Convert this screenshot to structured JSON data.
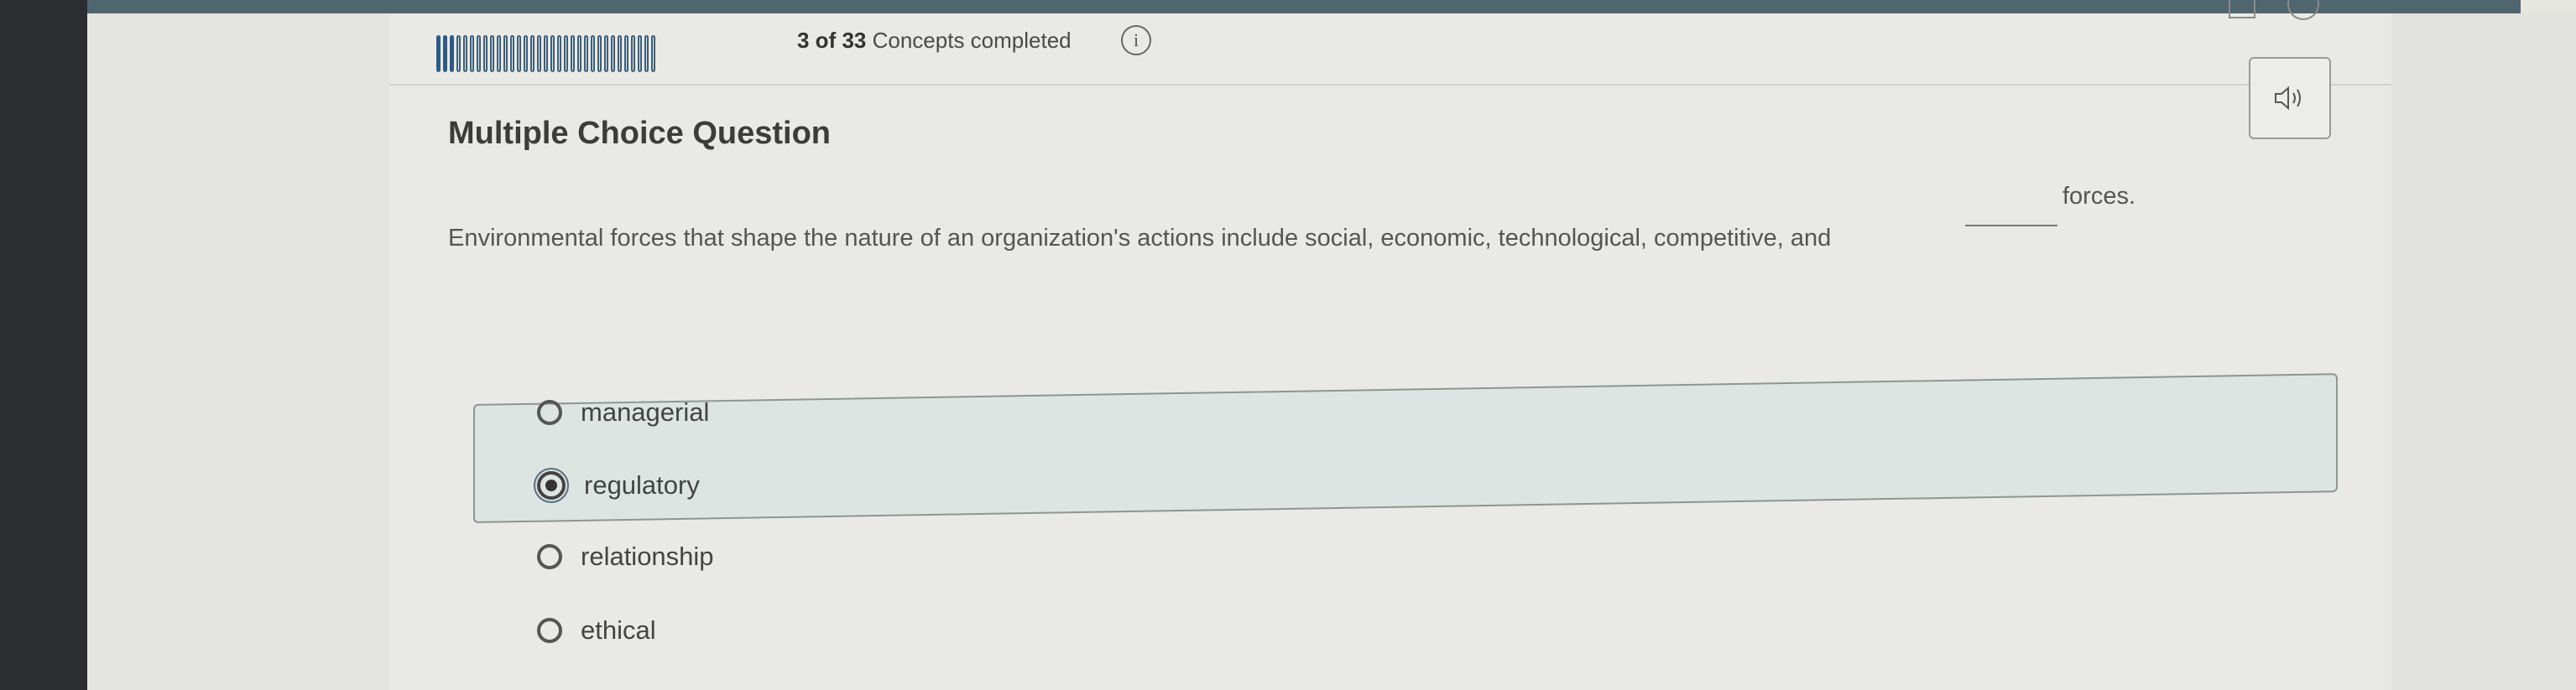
{
  "progress": {
    "completed": 3,
    "total": 33,
    "count_label": "3 of 33",
    "suffix_label": "Concepts completed"
  },
  "question": {
    "type_label": "Multiple Choice Question",
    "stem": "Environmental forces that shape the nature of an organization's actions include social, economic, technological, competitive, and",
    "stem_after_blank": "forces.",
    "options": [
      {
        "label": "managerial",
        "selected": false
      },
      {
        "label": "regulatory",
        "selected": true
      },
      {
        "label": "relationship",
        "selected": false
      },
      {
        "label": "ethical",
        "selected": false
      }
    ]
  },
  "icons": {
    "info": "info-icon",
    "speaker": "speaker-icon",
    "calculator": "calculator-icon",
    "check": "check-circle-icon"
  },
  "colors": {
    "progress_fill": "#2f5a86",
    "selected_highlight": "#dde5e2"
  }
}
